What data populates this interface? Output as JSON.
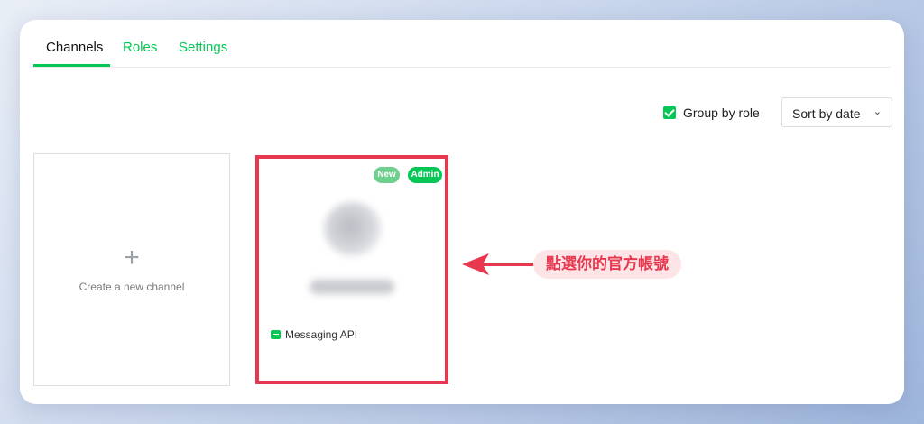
{
  "tabs": [
    {
      "label": "Channels",
      "active": true
    },
    {
      "label": "Roles",
      "active": false
    },
    {
      "label": "Settings",
      "active": false
    }
  ],
  "toolbar": {
    "group_by_role_label": "Group by role",
    "group_by_role_checked": true,
    "sort_label": "Sort by date"
  },
  "create_card": {
    "plus": "+",
    "label": "Create a new channel"
  },
  "channel_card": {
    "badge_new": "New",
    "badge_admin": "Admin",
    "type_label": "Messaging API"
  },
  "annotation": {
    "callout_text": "點選你的官方帳號"
  },
  "colors": {
    "accent": "#06c755",
    "highlight": "#e8384f",
    "callout_bg": "#fde4e6"
  }
}
